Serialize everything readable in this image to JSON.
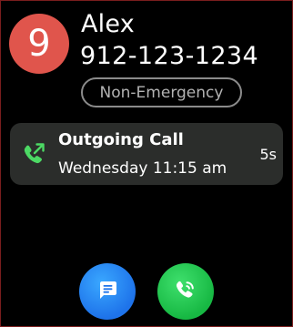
{
  "contact": {
    "avatar_label": "9",
    "name": "Alex",
    "phone": "912-123-1234",
    "status_badge": "Non-Emergency"
  },
  "last_call": {
    "type": "Outgoing Call",
    "timestamp": "Wednesday 11:15 am",
    "duration": "5s",
    "icon": "outgoing-call-icon"
  },
  "actions": {
    "message_icon": "message-icon",
    "call_icon": "call-icon"
  },
  "colors": {
    "avatar": "#e0554c",
    "call_icon": "#4cd964",
    "message_button": "#1e73ea",
    "call_button": "#17b843"
  }
}
